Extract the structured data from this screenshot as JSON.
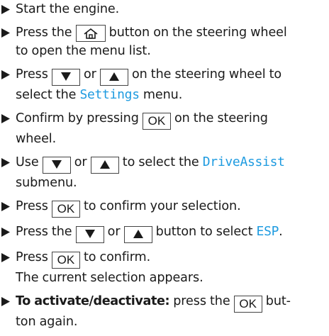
{
  "steps": [
    {
      "t1": "Start the engine."
    },
    {
      "t1": "Press the",
      "t2": "button on the steering wheel",
      "t3": "to open the menu list.",
      "icon_home": "home-icon"
    },
    {
      "t1": "Press",
      "t2": "or",
      "t3": "on the steering wheel to",
      "t4": "select the",
      "menu": "Settings",
      "t5": "menu.",
      "icons": [
        "arrow-down-icon",
        "arrow-up-icon"
      ]
    },
    {
      "t1": "Confirm by pressing",
      "key": "OK",
      "t2": "on the steering",
      "t3": "wheel."
    },
    {
      "t1": "Use",
      "t2": "or",
      "t3": "to select the",
      "menu": "DriveAssist",
      "t4": "submenu."
    },
    {
      "t1": "Press",
      "key": "OK",
      "t2": "to confirm your selection."
    },
    {
      "t1": "Press the",
      "t2": "or",
      "t3": "button to select",
      "menu": "ESP",
      "t4": "."
    },
    {
      "t1": "Press",
      "key": "OK",
      "t2": "to confirm.",
      "t3": "The current selection appears."
    },
    {
      "bold": "To activate/deactivate:",
      "t1": "press the",
      "key": "OK",
      "t2": "but-",
      "t3": "ton again."
    }
  ],
  "colors": {
    "menu_text": "#1e9be0",
    "text": "#1a1a1a",
    "key_border": "#444444"
  }
}
